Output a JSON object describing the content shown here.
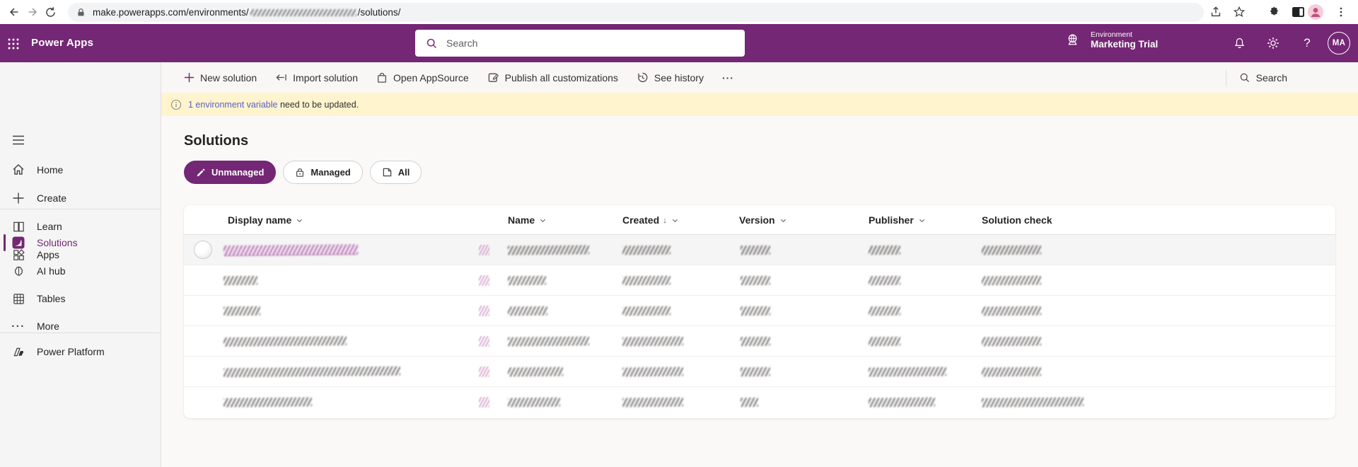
{
  "browser": {
    "url_prefix": "make.powerapps.com/environments/",
    "url_suffix": "/solutions/"
  },
  "app_header": {
    "product": "Power Apps",
    "search_placeholder": "Search",
    "environment_label": "Environment",
    "environment_name": "Marketing Trial",
    "help_glyph": "?",
    "avatar_initials": "MA"
  },
  "sidebar": {
    "items": [
      {
        "label": "Home"
      },
      {
        "label": "Create"
      },
      {
        "label": "Learn"
      },
      {
        "label": "Apps"
      },
      {
        "label": "Solutions",
        "selected": true
      },
      {
        "label": "AI hub"
      },
      {
        "label": "Tables"
      },
      {
        "label": "More",
        "dots": "···"
      }
    ],
    "footer": {
      "label": "Power Platform"
    }
  },
  "toolbar": {
    "actions": [
      {
        "label": "New solution"
      },
      {
        "label": "Import solution"
      },
      {
        "label": "Open AppSource"
      },
      {
        "label": "Publish all customizations"
      },
      {
        "label": "See history"
      }
    ],
    "overflow": "···",
    "search_label": "Search"
  },
  "banner": {
    "link_text": "1 environment variable",
    "message_rest": " need to be updated."
  },
  "main": {
    "title": "Solutions",
    "filters": [
      {
        "label": "Unmanaged",
        "selected": true
      },
      {
        "label": "Managed",
        "selected": false
      },
      {
        "label": "All",
        "selected": false
      }
    ]
  },
  "table": {
    "columns": [
      {
        "label": "Display name",
        "chevron": true,
        "sorted": false
      },
      {
        "label": "Name",
        "chevron": true,
        "sorted": false
      },
      {
        "label": "Created",
        "chevron": true,
        "sorted": true,
        "sort_glyph": "↓"
      },
      {
        "label": "Version",
        "chevron": true,
        "sorted": false
      },
      {
        "label": "Publisher",
        "chevron": true,
        "sorted": false
      },
      {
        "label": "Solution check",
        "chevron": false,
        "sorted": false
      }
    ],
    "rows": [
      {
        "selected": true,
        "spinner": true,
        "display_w": 190,
        "display_link": true,
        "name_w": 115,
        "created_w": 68,
        "version_w": 42,
        "publisher_w": 45,
        "check_w": 84
      },
      {
        "selected": false,
        "spinner": false,
        "display_w": 48,
        "display_link": false,
        "name_w": 54,
        "created_w": 68,
        "version_w": 42,
        "publisher_w": 45,
        "check_w": 84
      },
      {
        "selected": false,
        "spinner": false,
        "display_w": 52,
        "display_link": false,
        "name_w": 56,
        "created_w": 68,
        "version_w": 42,
        "publisher_w": 45,
        "check_w": 84
      },
      {
        "selected": false,
        "spinner": false,
        "display_w": 174,
        "display_link": false,
        "name_w": 115,
        "created_w": 86,
        "version_w": 42,
        "publisher_w": 45,
        "check_w": 84
      },
      {
        "selected": false,
        "spinner": false,
        "display_w": 250,
        "display_link": false,
        "name_w": 78,
        "created_w": 86,
        "version_w": 42,
        "publisher_w": 110,
        "check_w": 84
      },
      {
        "selected": false,
        "spinner": false,
        "display_w": 125,
        "display_link": false,
        "name_w": 74,
        "created_w": 86,
        "version_w": 25,
        "publisher_w": 94,
        "check_w": 144
      }
    ]
  },
  "colors": {
    "brand_purple": "#742774",
    "banner_bg": "#FFF4CE",
    "banner_link": "#5B5FC7",
    "sidebar_bg": "#F5F5F5"
  }
}
